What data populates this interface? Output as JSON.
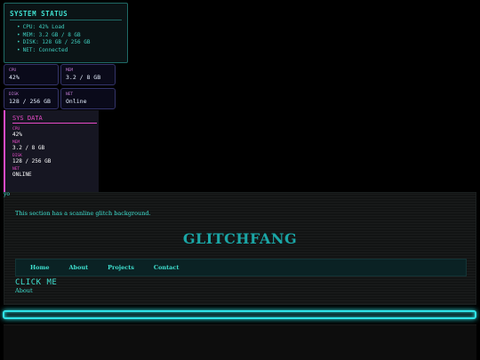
{
  "status_panel": {
    "title": "SYSTEM STATUS",
    "items": [
      "CPU: 42% Load",
      "MEM: 3.2 GB / 8 GB",
      "DISK: 128 GB / 256 GB",
      "NET: Connected"
    ]
  },
  "mini_cards": {
    "cpu": {
      "label": "CPU",
      "value": "42%"
    },
    "mem": {
      "label": "MEM",
      "value": "3.2 / 8 GB"
    },
    "disk": {
      "label": "DISK",
      "value": "128 / 256 GB"
    },
    "net": {
      "label": "NET",
      "value": "Online"
    }
  },
  "sys_data": {
    "title": "SYS DATA",
    "rows": [
      {
        "label": "CPU",
        "value": "42%"
      },
      {
        "label": "MEM",
        "value": "3.2 / 8 GB"
      },
      {
        "label": "DISK",
        "value": "128 / 256 GB"
      },
      {
        "label": "NET",
        "value": "ONLINE"
      }
    ]
  },
  "yo_text": "yo",
  "glitch_section": {
    "description": "This section has a scanline glitch background.",
    "heading": "GLITCHFANG",
    "nav": [
      "Home",
      "About",
      "Projects",
      "Contact"
    ],
    "click_me": "CLICK ME",
    "about": "About"
  },
  "colors": {
    "accent_cyan": "#3fe0d0",
    "accent_magenta": "#e54bc7",
    "glow": "#2fe4e8"
  }
}
